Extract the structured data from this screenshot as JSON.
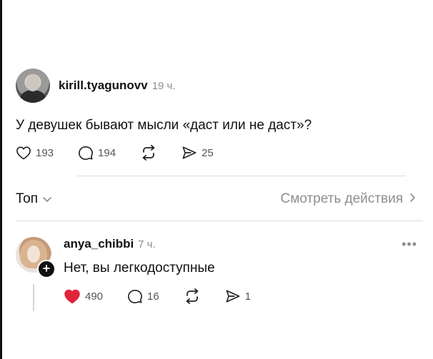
{
  "post": {
    "username": "kirill.tyagunovv",
    "time": "19 ч.",
    "text": "У девушек бывают мысли «даст или не даст»?",
    "likes": "193",
    "comments": "194",
    "shares": "25"
  },
  "sort": {
    "label": "Топ",
    "activity_link": "Смотреть действия"
  },
  "reply": {
    "username": "anya_chibbi",
    "time": "7 ч.",
    "text": "Нет, вы легкодоступные",
    "more": "•••",
    "likes": "490",
    "comments": "16",
    "shares": "1",
    "liked": true
  },
  "colors": {
    "like_active": "#e0243a",
    "muted": "#8e8e8e",
    "divider": "#dcdcdc"
  },
  "icons": [
    "heart-icon",
    "comment-icon",
    "repost-icon",
    "send-icon",
    "chevron-down-icon",
    "chevron-right-icon",
    "plus-icon",
    "more-icon"
  ]
}
